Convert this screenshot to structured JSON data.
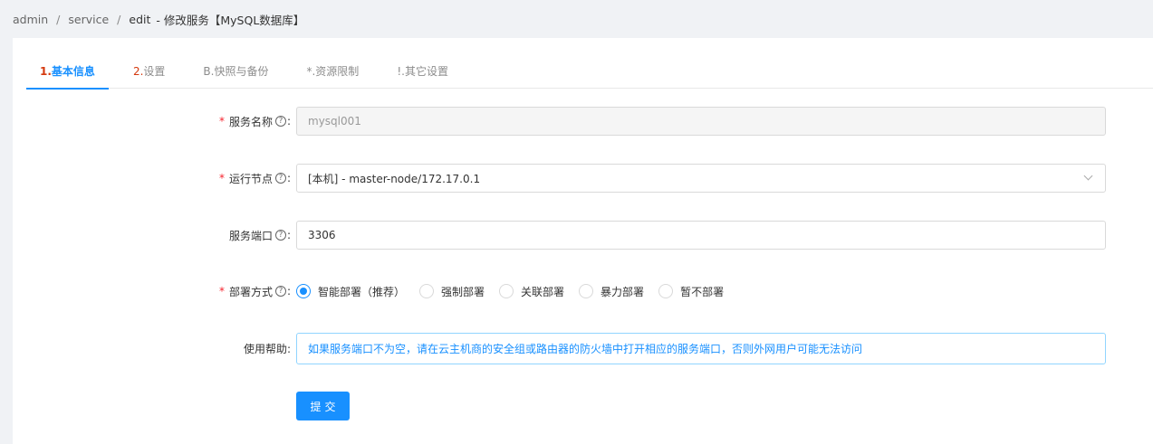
{
  "breadcrumb": [
    "admin",
    "service",
    "edit",
    "- 修改服务【MySQL数据库】"
  ],
  "tabs": [
    {
      "num": "1.",
      "label": "基本信息"
    },
    {
      "num": "2.",
      "label": "设置"
    },
    {
      "num": "B.",
      "label": "快照与备份"
    },
    {
      "num": "*.",
      "label": "资源限制"
    },
    {
      "num": "!.",
      "label": "其它设置"
    }
  ],
  "form": {
    "service_name": {
      "label": "服务名称",
      "value": "mysql001"
    },
    "run_node": {
      "label": "运行节点",
      "value": "[本机] - master-node/172.17.0.1"
    },
    "service_port": {
      "label": "服务端口",
      "value": "3306"
    },
    "deploy_mode": {
      "label": "部署方式",
      "options": [
        "智能部署（推荐）",
        "强制部署",
        "关联部署",
        "暴力部署",
        "暂不部署"
      ],
      "selected": "智能部署（推荐）"
    },
    "usage_help": {
      "label": "使用帮助:",
      "text": "如果服务端口不为空，请在云主机商的安全组或路由器的防火墙中打开相应的服务端口，否则外网用户可能无法访问"
    }
  },
  "submit_label": "提交",
  "required_mark": "*",
  "help_glyph": "?",
  "colon": ":",
  "colors": {
    "accent": "#1890ff",
    "required": "#f5222d",
    "tab_num": "#d4380d"
  }
}
